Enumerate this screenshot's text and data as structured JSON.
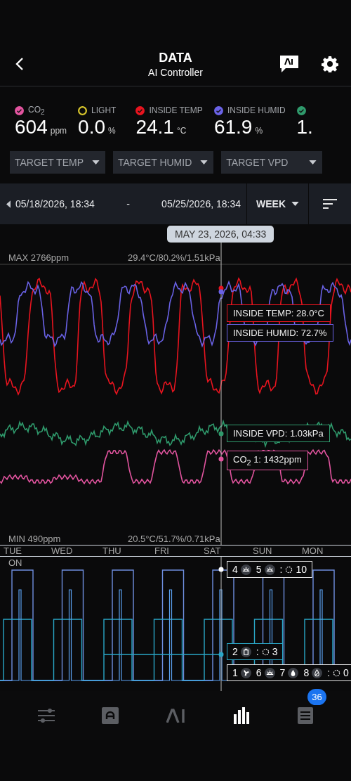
{
  "header": {
    "title": "DATA",
    "subtitle": "AI Controller"
  },
  "sensors": [
    {
      "label": "CO$_{2}$",
      "value": "604",
      "unit": "ppm",
      "checked": true,
      "color": "#e2549f"
    },
    {
      "label": "LIGHT",
      "value": "0.0",
      "unit": "%",
      "checked": false,
      "color": "#d8c62c"
    },
    {
      "label": "INSIDE TEMP",
      "value": "24.1",
      "unit": "°C",
      "checked": true,
      "color": "#e8141f"
    },
    {
      "label": "INSIDE HUMID",
      "value": "61.9",
      "unit": "%",
      "checked": true,
      "color": "#6a62e6"
    },
    {
      "value": "1.",
      "checked": true,
      "color": "#2f9a6c"
    }
  ],
  "targets": [
    "TARGET TEMP",
    "TARGET HUMID",
    "TARGET VPD"
  ],
  "range": {
    "start": "05/18/2026, 18:34",
    "separator": "-",
    "end": "05/25/2026, 18:34",
    "period": "WEEK"
  },
  "chart": {
    "cursor_time": "MAY 23, 2026, 04:33",
    "max_label": "MAX 2766ppm",
    "max_values": "29.4°C/80.2%/1.51kPa",
    "min_label": "MIN 490ppm",
    "min_values": "20.5°C/51.7%/0.71kPa",
    "legends": [
      {
        "kind": "temp",
        "text": "INSIDE TEMP: 28.0°C",
        "color": "#e8141f"
      },
      {
        "kind": "humid",
        "text": "INSIDE HUMID: 72.7%",
        "color": "#6a62e6"
      },
      {
        "kind": "vpd",
        "text": "INSIDE VPD: 1.03kPa",
        "color": "#2f9a6c"
      },
      {
        "kind": "co2",
        "text": "CO$_{2}$ 1: 1432ppm",
        "color": "#e2549f"
      }
    ],
    "days": [
      "TUE",
      "WED",
      "THU",
      "FRI",
      "SAT",
      "SUN",
      "MON"
    ],
    "state_label": "ON",
    "tags": [
      {
        "color": "#e6e6e6",
        "devices": [
          {
            "num": "4",
            "kind": "light"
          },
          {
            "num": "5",
            "kind": "light"
          }
        ],
        "separator": ":",
        "count": "10"
      },
      {
        "color": "#2aa7c7",
        "devices": [
          {
            "num": "2",
            "kind": "outlet"
          }
        ],
        "separator": ":",
        "count": "3"
      },
      {
        "color": "#e6e6e6",
        "devices": [
          {
            "num": "1",
            "kind": "fan"
          },
          {
            "num": "6",
            "kind": "light"
          },
          {
            "num": "7",
            "kind": "drop"
          },
          {
            "num": "8",
            "kind": "drop-outline"
          }
        ],
        "separator": ":",
        "count": "0"
      }
    ]
  },
  "nav": [
    {
      "kind": "sliders",
      "selected": false
    },
    {
      "kind": "controller",
      "selected": false
    },
    {
      "kind": "ai",
      "selected": false
    },
    {
      "kind": "chart",
      "selected": true
    },
    {
      "kind": "list",
      "selected": false,
      "badge": "36"
    }
  ]
}
